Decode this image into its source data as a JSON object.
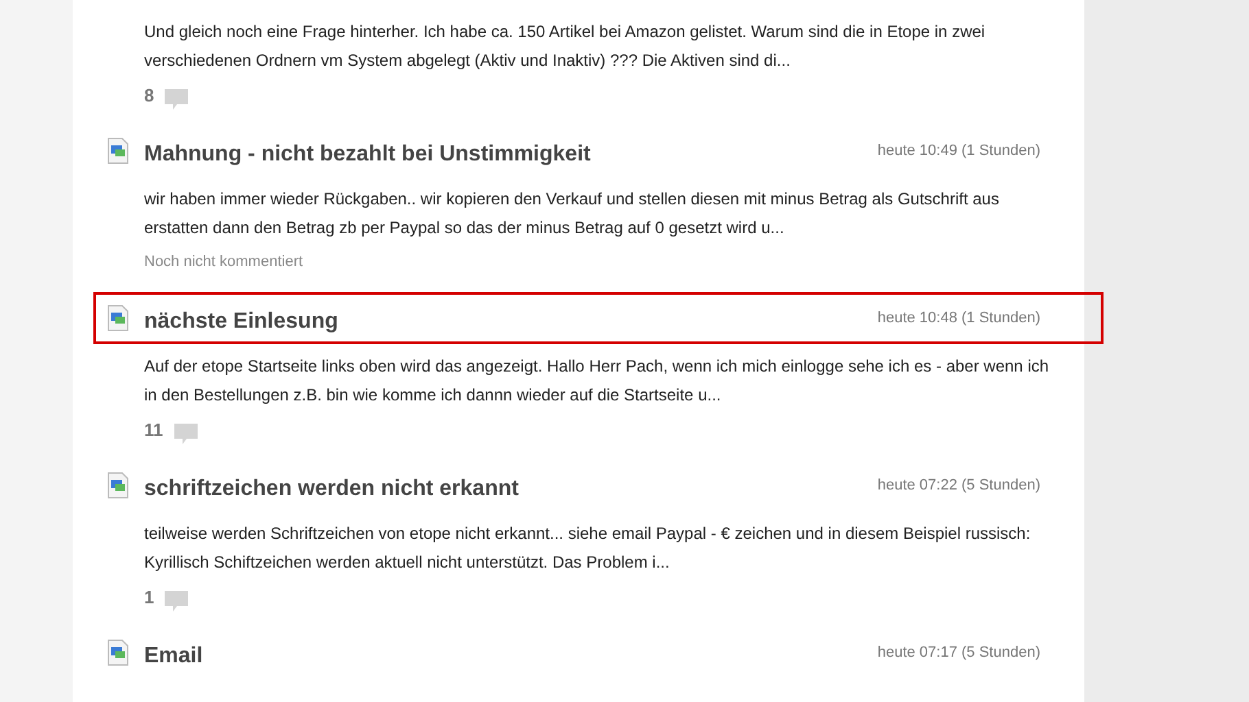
{
  "posts": [
    {
      "highlighted": false,
      "body": "Und gleich noch eine Frage hinterher. Ich habe ca. 150 Artikel bei Amazon gelistet. Warum sind die in Etope in zwei verschiedenen Ordnern vm System abgelegt (Aktiv und Inaktiv) ??? Die Aktiven sind di...",
      "footer": {
        "kind": "comments",
        "count": "8"
      }
    },
    {
      "highlighted": false,
      "title": "Mahnung - nicht bezahlt bei Unstimmigkeit",
      "time": "heute 10:49 (1 Stunden)",
      "body": "wir haben immer wieder Rückgaben.. wir kopieren den Verkauf und stellen diesen mit minus Betrag als Gutschrift aus erstatten dann den Betrag zb per Paypal so das der minus Betrag auf 0 gesetzt wird u...",
      "footer": {
        "kind": "note",
        "text": "Noch nicht kommentiert"
      }
    },
    {
      "highlighted": true,
      "title": "nächste Einlesung",
      "time": "heute 10:48 (1 Stunden)",
      "body": "Auf der etope Startseite links oben wird das angezeigt. Hallo Herr Pach, wenn ich mich einlogge sehe ich es - aber wenn ich in den Bestellungen z.B. bin wie komme ich dannn wieder auf die Startseite u...",
      "footer": {
        "kind": "comments",
        "count": "11"
      }
    },
    {
      "highlighted": false,
      "title": "schriftzeichen werden nicht erkannt",
      "time": "heute 07:22 (5 Stunden)",
      "body": "teilweise werden Schriftzeichen von etope nicht erkannt... siehe email Paypal - € zeichen und in diesem Beispiel russisch: Kyrillisch Schiftzeichen werden aktuell nicht unterstützt. Das Problem i...",
      "footer": {
        "kind": "comments",
        "count": "1"
      }
    },
    {
      "highlighted": false,
      "title": "Email",
      "time": "heute 07:17 (5 Stunden)"
    }
  ]
}
